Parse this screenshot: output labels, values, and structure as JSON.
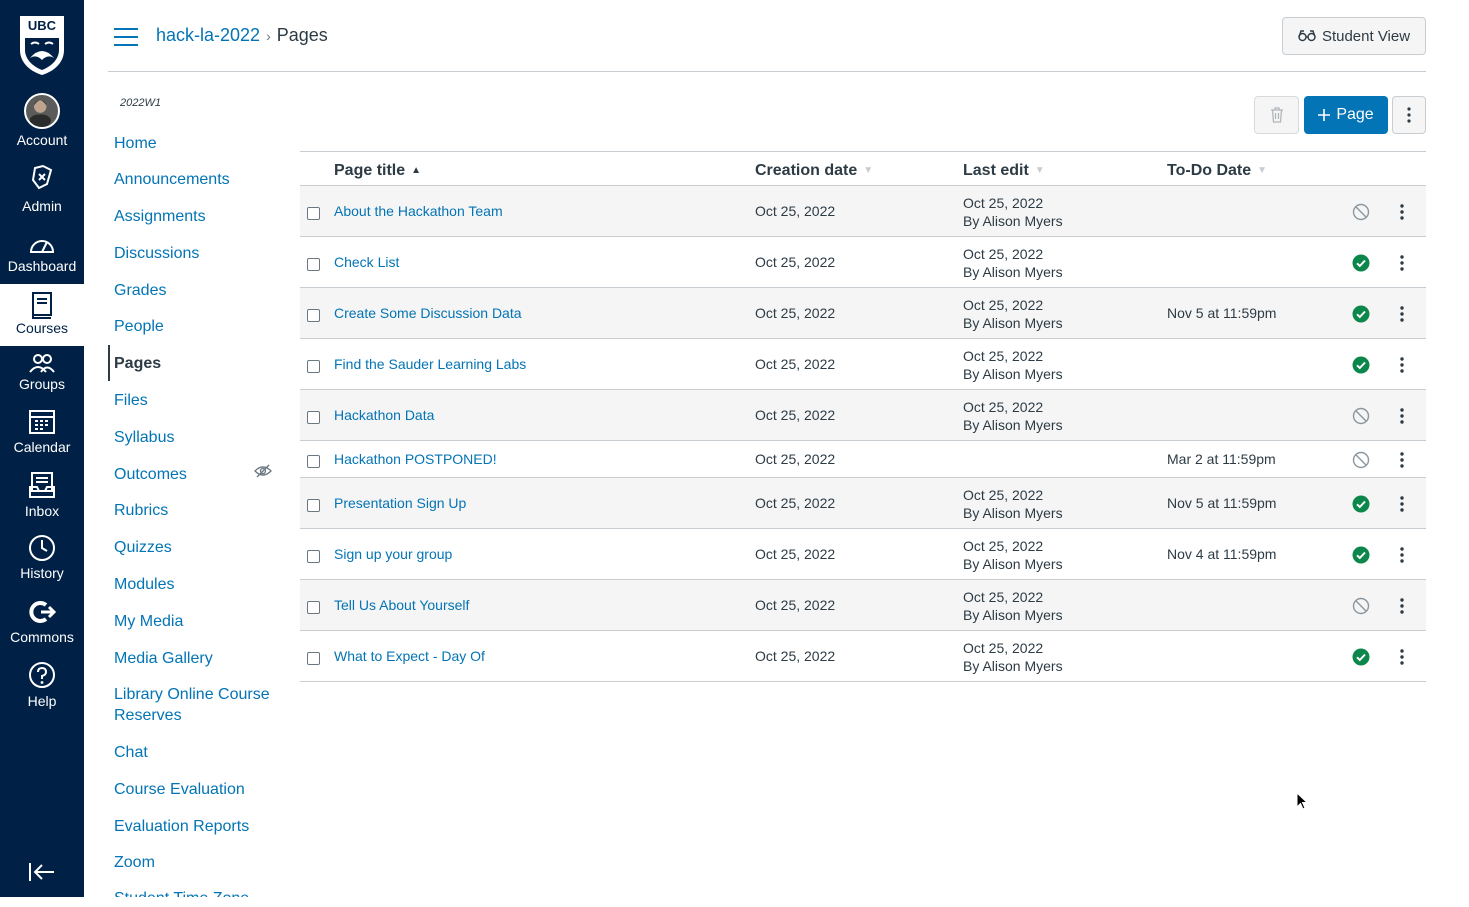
{
  "global_nav": {
    "logo": "UBC",
    "items": [
      {
        "label": "Account",
        "icon": "avatar-icon"
      },
      {
        "label": "Admin",
        "icon": "admin-shield-icon"
      },
      {
        "label": "Dashboard",
        "icon": "dashboard-icon"
      },
      {
        "label": "Courses",
        "icon": "courses-book-icon"
      },
      {
        "label": "Groups",
        "icon": "groups-icon"
      },
      {
        "label": "Calendar",
        "icon": "calendar-icon"
      },
      {
        "label": "Inbox",
        "icon": "inbox-icon"
      },
      {
        "label": "History",
        "icon": "history-clock-icon"
      },
      {
        "label": "Commons",
        "icon": "commons-icon"
      },
      {
        "label": "Help",
        "icon": "help-icon"
      }
    ]
  },
  "header": {
    "course": "hack-la-2022",
    "separator": "›",
    "current": "Pages",
    "student_view": "Student View"
  },
  "course_nav": {
    "term": "2022W1",
    "items": [
      "Home",
      "Announcements",
      "Assignments",
      "Discussions",
      "Grades",
      "People",
      "Pages",
      "Files",
      "Syllabus",
      "Outcomes",
      "Rubrics",
      "Quizzes",
      "Modules",
      "My Media",
      "Media Gallery",
      "Library Online Course Reserves",
      "Chat",
      "Course Evaluation",
      "Evaluation Reports",
      "Zoom",
      "Student Time Zone"
    ]
  },
  "toolbar": {
    "add_page": "Page"
  },
  "table": {
    "headers": {
      "title": "Page title",
      "created": "Creation date",
      "last_edit": "Last edit",
      "todo": "To-Do Date"
    },
    "rows": [
      {
        "title": "About the Hackathon Team",
        "created": "Oct 25, 2022",
        "edit_date": "Oct 25, 2022",
        "edit_by": "By Alison Myers",
        "todo": "",
        "published": false
      },
      {
        "title": "Check List",
        "created": "Oct 25, 2022",
        "edit_date": "Oct 25, 2022",
        "edit_by": "By Alison Myers",
        "todo": "",
        "published": true
      },
      {
        "title": "Create Some Discussion Data",
        "created": "Oct 25, 2022",
        "edit_date": "Oct 25, 2022",
        "edit_by": "By Alison Myers",
        "todo": "Nov 5 at 11:59pm",
        "published": true
      },
      {
        "title": "Find the Sauder Learning Labs",
        "created": "Oct 25, 2022",
        "edit_date": "Oct 25, 2022",
        "edit_by": "By Alison Myers",
        "todo": "",
        "published": true
      },
      {
        "title": "Hackathon Data",
        "created": "Oct 25, 2022",
        "edit_date": "Oct 25, 2022",
        "edit_by": "By Alison Myers",
        "todo": "",
        "published": false
      },
      {
        "title": "Hackathon POSTPONED!",
        "created": "Oct 25, 2022",
        "edit_date": "",
        "edit_by": "",
        "todo": "Mar 2 at 11:59pm",
        "published": false
      },
      {
        "title": "Presentation Sign Up",
        "created": "Oct 25, 2022",
        "edit_date": "Oct 25, 2022",
        "edit_by": "By Alison Myers",
        "todo": "Nov 5 at 11:59pm",
        "published": true
      },
      {
        "title": "Sign up your group",
        "created": "Oct 25, 2022",
        "edit_date": "Oct 25, 2022",
        "edit_by": "By Alison Myers",
        "todo": "Nov 4 at 11:59pm",
        "published": true
      },
      {
        "title": "Tell Us About Yourself",
        "created": "Oct 25, 2022",
        "edit_date": "Oct 25, 2022",
        "edit_by": "By Alison Myers",
        "todo": "",
        "published": false
      },
      {
        "title": "What to Expect - Day Of",
        "created": "Oct 25, 2022",
        "edit_date": "Oct 25, 2022",
        "edit_by": "By Alison Myers",
        "todo": "",
        "published": true
      }
    ]
  },
  "colors": {
    "nav_bg": "#002145",
    "link": "#0374b5",
    "published": "#0b874b",
    "unpublished": "#8b969e"
  }
}
